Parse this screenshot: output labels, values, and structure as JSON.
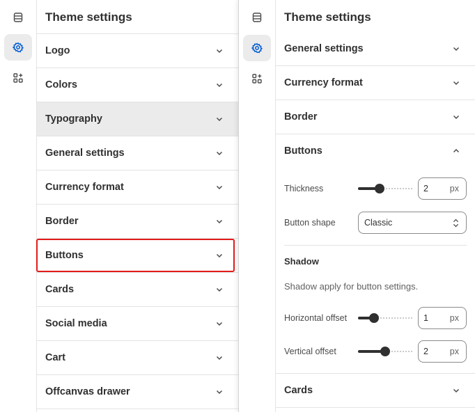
{
  "left_panel": {
    "title": "Theme settings",
    "sections": [
      {
        "label": "Logo"
      },
      {
        "label": "Colors"
      },
      {
        "label": "Typography"
      },
      {
        "label": "General settings"
      },
      {
        "label": "Currency format"
      },
      {
        "label": "Border"
      },
      {
        "label": "Buttons"
      },
      {
        "label": "Cards"
      },
      {
        "label": "Social media"
      },
      {
        "label": "Cart"
      },
      {
        "label": "Offcanvas drawer"
      }
    ],
    "hovered_section": "Typography",
    "highlighted_section": "Buttons"
  },
  "right_panel": {
    "title": "Theme settings",
    "sections_top": [
      {
        "label": "General settings"
      },
      {
        "label": "Currency format"
      },
      {
        "label": "Border"
      }
    ],
    "expanded_section": {
      "label": "Buttons",
      "thickness": {
        "label": "Thickness",
        "value": "2",
        "unit": "px",
        "slider_fraction": 0.4
      },
      "button_shape": {
        "label": "Button shape",
        "value": "Classic"
      },
      "shadow_heading": "Shadow",
      "shadow_note": "Shadow apply for button settings.",
      "horizontal_offset": {
        "label": "Horizontal offset",
        "value": "1",
        "unit": "px",
        "slider_fraction": 0.3
      },
      "vertical_offset": {
        "label": "Vertical offset",
        "value": "2",
        "unit": "px",
        "slider_fraction": 0.5
      }
    },
    "sections_bottom": [
      {
        "label": "Cards"
      }
    ]
  },
  "rail": {
    "items": [
      {
        "icon": "sections-icon"
      },
      {
        "icon": "gear-icon",
        "active": true
      },
      {
        "icon": "apps-add-icon"
      }
    ]
  },
  "colors": {
    "highlight_outline": "#e31b1b",
    "active_icon": "#005bd3",
    "hover_row": "#ebebeb"
  }
}
